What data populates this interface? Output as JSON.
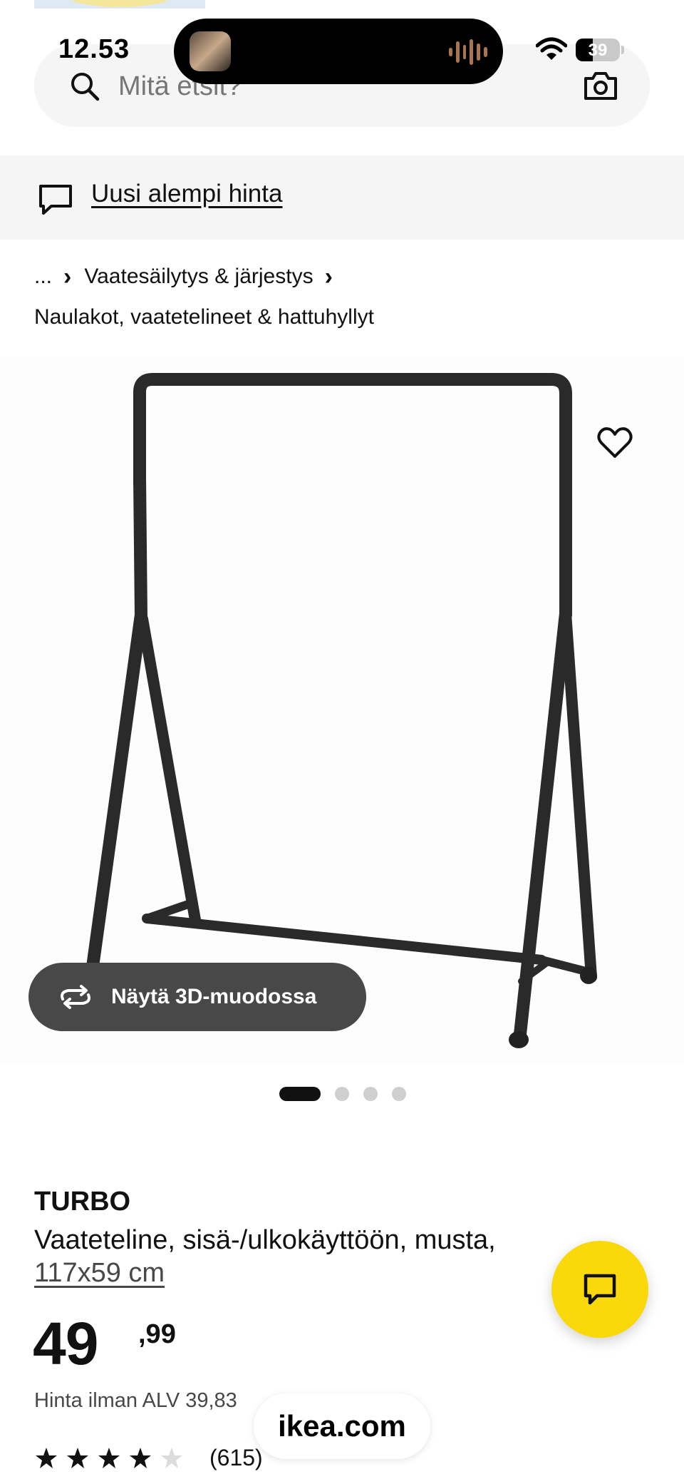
{
  "status_bar": {
    "time": "12.53",
    "battery_level": "39",
    "icons": [
      "wifi-icon",
      "battery-icon"
    ]
  },
  "search": {
    "placeholder": "Mitä etsit?",
    "icons": [
      "search-icon",
      "camera-icon"
    ]
  },
  "banner": {
    "label": "Uusi alempi hinta",
    "icon": "speech-bubble-icon"
  },
  "breadcrumb": {
    "ellipsis": "...",
    "level_1": "Vaatesäilytys & järjestys",
    "level_2": "Naulakot, vaatetelineet & hattuhyllyt"
  },
  "gallery": {
    "view_3d_label": "Näytä 3D-muodossa",
    "image_count": 4,
    "active_index": 0
  },
  "product": {
    "name": "TURBO",
    "description": "Vaateteline, sisä-/ulkokäyttöön, musta,",
    "size": "117x59 cm",
    "price_integer": "49",
    "price_decimals": ",99",
    "price_without_vat": "Hinta ilman ALV 39,83",
    "rating": 4,
    "rating_max": 5,
    "review_count": "(615)"
  },
  "browser": {
    "url": "ikea.com"
  },
  "colors": {
    "accent_yellow": "#f9d90a",
    "surface_grey": "#f5f5f5",
    "button_dark": "#484848"
  }
}
